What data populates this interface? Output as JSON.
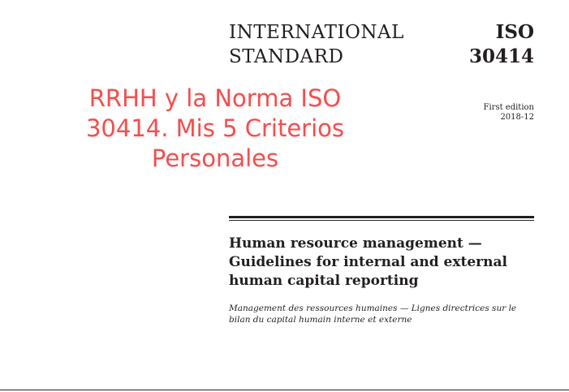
{
  "header": {
    "type_line1": "INTERNATIONAL",
    "type_line2": "STANDARD",
    "code_line1": "ISO",
    "code_line2": "30414"
  },
  "edition": {
    "label": "First edition",
    "date": "2018-12"
  },
  "overlay": {
    "line1": "RRHH y la Norma ISO",
    "line2": "30414. Mis 5 Criterios",
    "line3": "Personales",
    "color": "#f05050"
  },
  "title": {
    "line1": "Human resource management —",
    "line2": "Guidelines for internal and external",
    "line3": "human capital reporting"
  },
  "alt_title": {
    "line1": "Management des ressources humaines — Lignes directrices sur le",
    "line2": "bilan du capital humain interne et externe"
  }
}
